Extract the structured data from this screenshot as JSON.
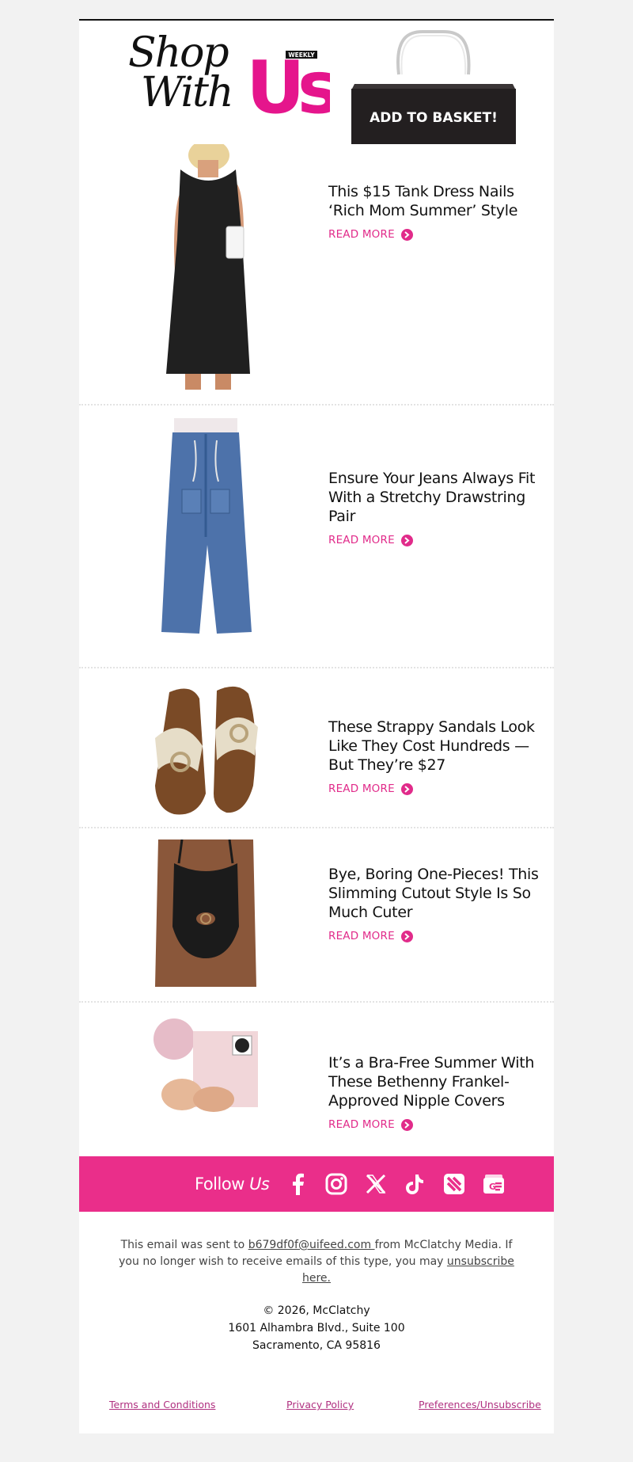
{
  "header": {
    "shop_line1": "Shop",
    "shop_line2": "With",
    "brand_letters": "Us",
    "brand_tag": "WEEKLY",
    "bag_label": "ADD TO BASKET!"
  },
  "products": [
    {
      "title": "This $15 Tank Dress Nails ‘Rich Mom Summer’ Style",
      "cta": "READ MORE",
      "image": "black-tank-dress"
    },
    {
      "title": "Ensure Your Jeans Always Fit With a Stretchy Drawstring Pair",
      "cta": "READ MORE",
      "image": "drawstring-jeans"
    },
    {
      "title": "These Strappy Sandals Look Like They Cost Hundreds — But They’re $27",
      "cta": "READ MORE",
      "image": "strappy-sandals"
    },
    {
      "title": "Bye, Boring One-Pieces! This Slimming Cutout Style Is So Much Cuter",
      "cta": "READ MORE",
      "image": "cutout-swimsuit"
    },
    {
      "title": "It’s a Bra-Free Summer With These Bethenny Frankel-Approved Nipple Covers",
      "cta": "READ MORE",
      "image": "nipple-covers"
    }
  ],
  "follow": {
    "label": "Follow",
    "label_em": "Us",
    "icons": [
      "facebook-icon",
      "instagram-icon",
      "x-icon",
      "tiktok-icon",
      "apple-news-icon",
      "google-news-icon"
    ]
  },
  "footer": {
    "note_prefix": "This email was sent to ",
    "email": "b679df0f@uifeed.com ",
    "note_middle": "from McClatchy Media. If you no longer wish to receive emails of this type, you may ",
    "unsubscribe": "unsubscribe here.",
    "copyright": "© 2026, McClatchy",
    "address_line1": "1601 Alhambra Blvd., Suite 100",
    "address_line2": "Sacramento, CA 95816",
    "links": [
      "Terms and Conditions",
      "Privacy Policy",
      "Preferences/Unsubscribe"
    ]
  },
  "colors": {
    "accent": "#ea2e8a",
    "link": "#e12b8a",
    "background": "#f2f2f2"
  }
}
